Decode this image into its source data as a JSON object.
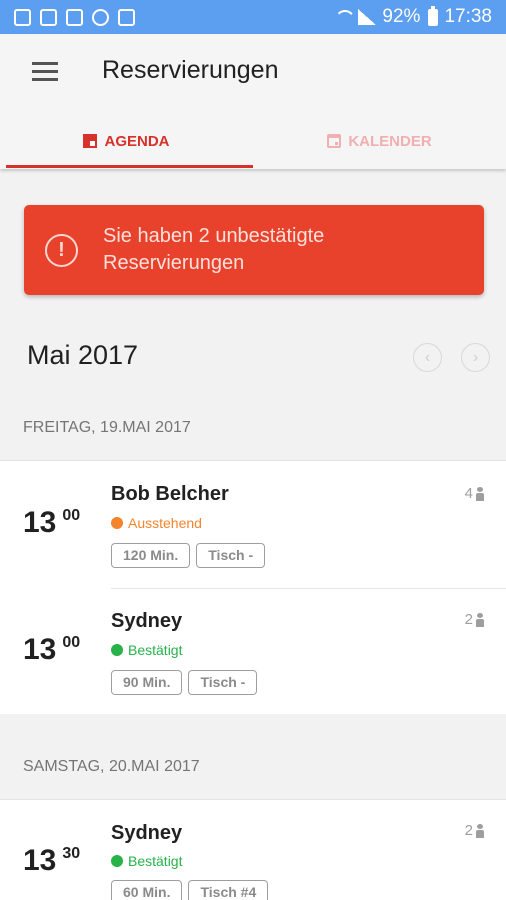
{
  "statusbar": {
    "icons": [
      "image-icon",
      "photo-stack-icon",
      "sim-icon",
      "sync-icon",
      "mail-icon"
    ],
    "battery": "92%",
    "time": "17:38"
  },
  "appbar": {
    "title": "Reservierungen",
    "tabs": [
      {
        "label": "AGENDA",
        "icon": "agenda-icon",
        "active": true
      },
      {
        "label": "KALENDER",
        "icon": "calendar-icon",
        "active": false
      }
    ]
  },
  "alert": {
    "text": "Sie haben 2 unbestätigte Reservierungen",
    "icon": "exclamation-circle-icon",
    "color": "#e8412c"
  },
  "month": {
    "title": "Mai 2017",
    "prev_icon": "chevron-left-icon",
    "next_icon": "chevron-right-icon"
  },
  "days": [
    {
      "label": "FREITAG, 19.MAI 2017",
      "reservations": [
        {
          "hour": "13",
          "minute": "00",
          "name": "Bob Belcher",
          "status": "Ausstehend",
          "status_color": "#f5842b",
          "duration": "120 Min.",
          "table": "Tisch -",
          "persons": "4"
        },
        {
          "hour": "13",
          "minute": "00",
          "name": "Sydney",
          "status": "Bestätigt",
          "status_color": "#27b24a",
          "duration": "90 Min.",
          "table": "Tisch -",
          "persons": "2"
        }
      ]
    },
    {
      "label": "SAMSTAG, 20.MAI 2017",
      "reservations": [
        {
          "hour": "13",
          "minute": "30",
          "name": "Sydney",
          "status": "Bestätigt",
          "status_color": "#27b24a",
          "duration": "60 Min.",
          "table": "Tisch #4",
          "persons": "2"
        }
      ]
    }
  ],
  "colors": {
    "accent": "#d8302a",
    "statusbar": "#5c9ef0"
  }
}
